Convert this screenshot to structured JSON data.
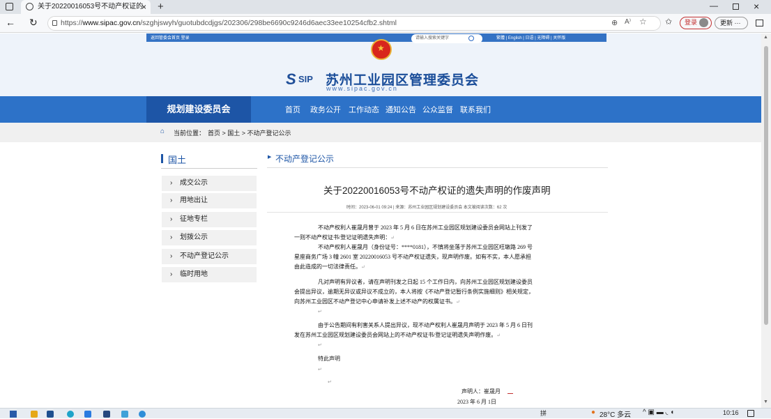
{
  "browser": {
    "tab_title": "关于20220016053号不动产权证的",
    "url_prefix": "https://",
    "url_host": "www.sipac.gov.cn",
    "url_path": "/szghjswyh/guotubdcdjgs/202306/298be6690c9246d6aec33ee10254cfb2.shtml",
    "login_label": "登录",
    "update_label": "更新"
  },
  "header": {
    "top_links": "返回管委会首页  登录",
    "search_placeholder": "请输入搜索关键字",
    "lang_links": "繁體  |  English  |  日语  |  无障碍  |  关怀版",
    "logo_sip": "SIP",
    "site_title": "苏州工业园区管理委员会",
    "site_url": "www.sipac.gov.cn"
  },
  "nav": {
    "dept": "规划建设委员会",
    "items": [
      "首页",
      "政务公开",
      "工作动态",
      "通知公告",
      "公众监督",
      "联系我们"
    ]
  },
  "breadcrumb": {
    "label": "当前位置：",
    "path": "首页 > 国土 > 不动产登记公示"
  },
  "sidebar": {
    "heading": "国土",
    "items": [
      "成交公示",
      "用地出让",
      "征地专栏",
      "划拨公示",
      "不动产登记公示",
      "临时用地"
    ]
  },
  "section": {
    "title": "不动产登记公示"
  },
  "article": {
    "title": "关于20220016053号不动产权证的遗失声明的作废声明",
    "meta": "时间：2023-06-01 09:24 | 来源：苏州工业园区规划建设委员会   本文被阅读次数：62 次",
    "p1": "不动产权利人崔晟月曾于 2023 年 5 月 6 日在苏州工业园区规划建设委员会网站上刊发了一则不动产权证书/登记证明遗失声明：",
    "p2": "不动产权利人崔晟月（身份证号：****0181），不慎将坐落于苏州工业园区旺墩路 269 号星座商务广场 3 幢 2601 室 20220016053 号不动产权证遗失，现声明作废。如有不实，本人愿承担由此造成的一切法律责任。",
    "p3": "凡对声明有异议者，请在声明刊发之日起 15 个工作日内，向苏州工业园区规划建设委员会提出异议，逾期无异议或异议不成立的，本人将按《不动产登记暂行条例实施细则》相关规定，向苏州工业园区不动产登记中心申请补发上述不动产的权属证书。",
    "p4": "由于公告期间有利害关系人提出异议，现不动产权利人崔晟月声明于 2023 年 5 月 6 日刊发在苏州工业园区规划建设委员会网站上的不动产权证书/登记证明遗失声明作废。",
    "p5": "特此声明",
    "sign": "声明人：崔晟月",
    "date": "2023 年  6  月  1日"
  },
  "taskbar": {
    "weather": "28°C 多云",
    "time": "10:16",
    "ime": "拼"
  }
}
